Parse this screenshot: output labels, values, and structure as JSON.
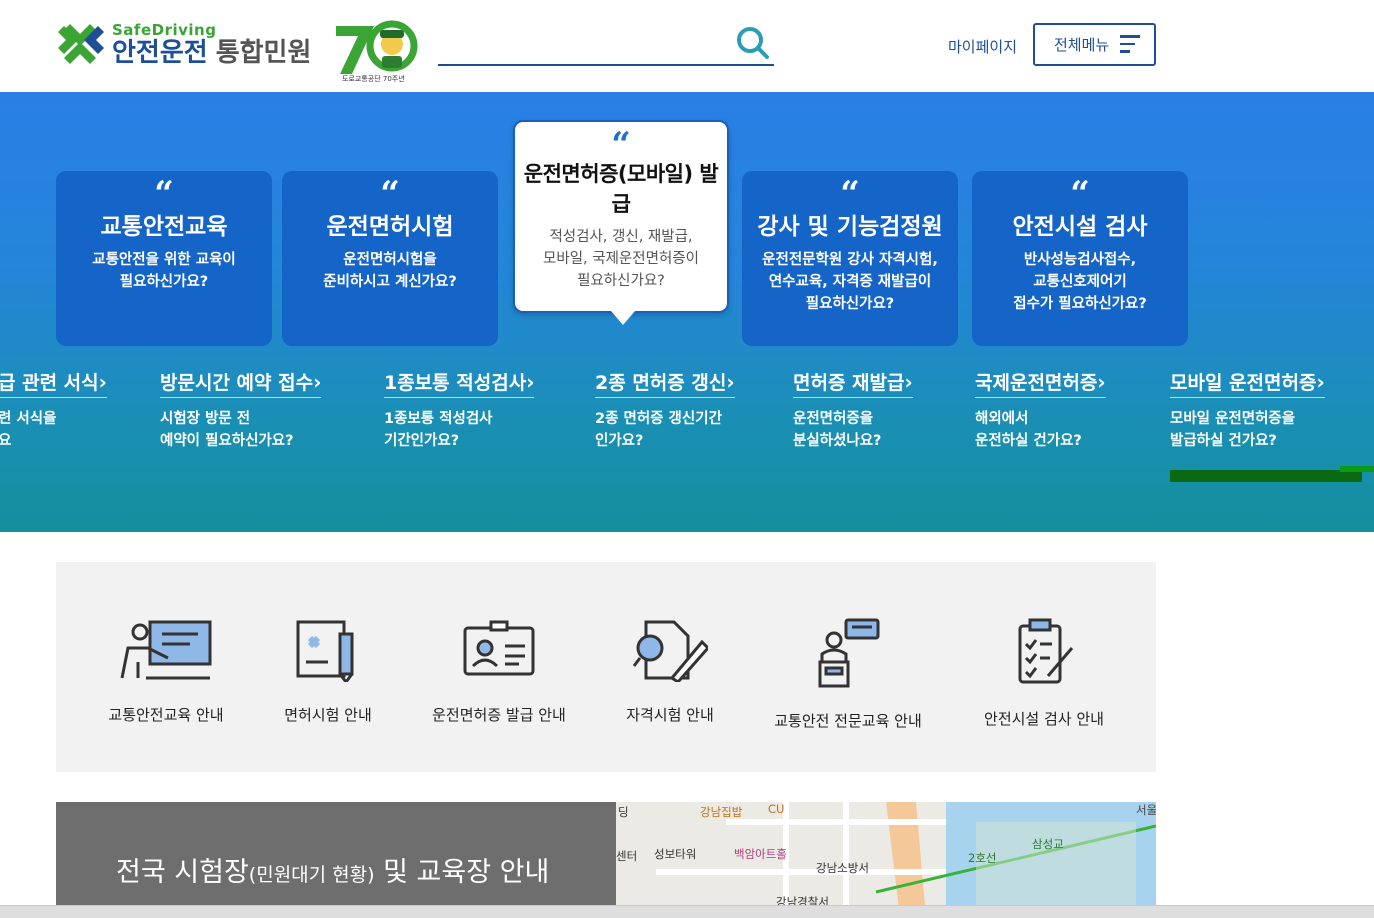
{
  "header": {
    "logo_sub": "SafeDriving",
    "logo_main": "안전운전",
    "logo_main2": "통합민원",
    "anniv_caption": "도로교통공단 70주년",
    "search_placeholder": "",
    "mypage": "마이페이지",
    "menu": "전체메뉴"
  },
  "hero": {
    "cards": [
      {
        "title": "교통안전교육",
        "desc1": "교통안전을 위한 교육이",
        "desc2": "필요하신가요?",
        "desc3": ""
      },
      {
        "title": "운전면허시험",
        "desc1": "운전면허시험을",
        "desc2": "준비하시고 계신가요?",
        "desc3": ""
      },
      {
        "title": "운전면허증(모바일) 발급",
        "desc1": "적성검사, 갱신, 재발급,",
        "desc2": "모바일, 국제운전면허증이",
        "desc3": "필요하신가요?"
      },
      {
        "title": "강사 및 기능검정원",
        "desc1": "운전전문학원 강사 자격시험,",
        "desc2": "연수교육, 자격증 재발급이",
        "desc3": "필요하신가요?"
      },
      {
        "title": "안전시설 검사",
        "desc1": "반사성능검사접수,",
        "desc2": "교통신호제어기",
        "desc3": "접수가 필요하신가요?"
      }
    ],
    "services": [
      {
        "title": "급 관련 서식",
        "d1": "련 서식을",
        "d2": "요"
      },
      {
        "title": "방문시간 예약 접수",
        "d1": "시험장 방문 전",
        "d2": "예약이 필요하신가요?"
      },
      {
        "title": "1종보통 적성검사",
        "d1": "1종보통 적성검사",
        "d2": "기간인가요?"
      },
      {
        "title": "2종 면허증 갱신",
        "d1": "2종 면허증 갱신기간",
        "d2": "인가요?"
      },
      {
        "title": "면허증 재발급",
        "d1": "운전면허증을",
        "d2": "분실하셨나요?"
      },
      {
        "title": "국제운전면허증",
        "d1": "해외에서",
        "d2": "운전하실 건가요?"
      },
      {
        "title": "모바일 운전면허증",
        "d1": "모바일 운전면허증을",
        "d2": "발급하실 건가요?"
      }
    ]
  },
  "quick": [
    {
      "label": "교통안전교육 안내",
      "icon": "presentation-icon"
    },
    {
      "label": "면허시험 안내",
      "icon": "license-test-icon"
    },
    {
      "label": "운전면허증 발급 안내",
      "icon": "id-card-icon"
    },
    {
      "label": "자격시험 안내",
      "icon": "exam-pen-icon"
    },
    {
      "label": "교통안전 전문교육 안내",
      "icon": "lecturer-icon"
    },
    {
      "label": "안전시설 검사 안내",
      "icon": "checklist-icon"
    }
  ],
  "exam": {
    "title": "전국 시험장",
    "sub": "(민원대기 현황)",
    "tail": " 및 교육장 안내"
  },
  "map": {
    "labels": [
      "강남집밥",
      "CU",
      "성보타워",
      "백암아트홀",
      "강남소방서",
      "삼성교",
      "2호선",
      "센터",
      "딩",
      "서울",
      "강남경찰서"
    ]
  },
  "colors": {
    "brand": "#1f4e99",
    "hero_top": "#2a7fe6",
    "hero_bottom": "#148f9c",
    "card": "#1565c8",
    "logo_green": "#3aa535"
  }
}
